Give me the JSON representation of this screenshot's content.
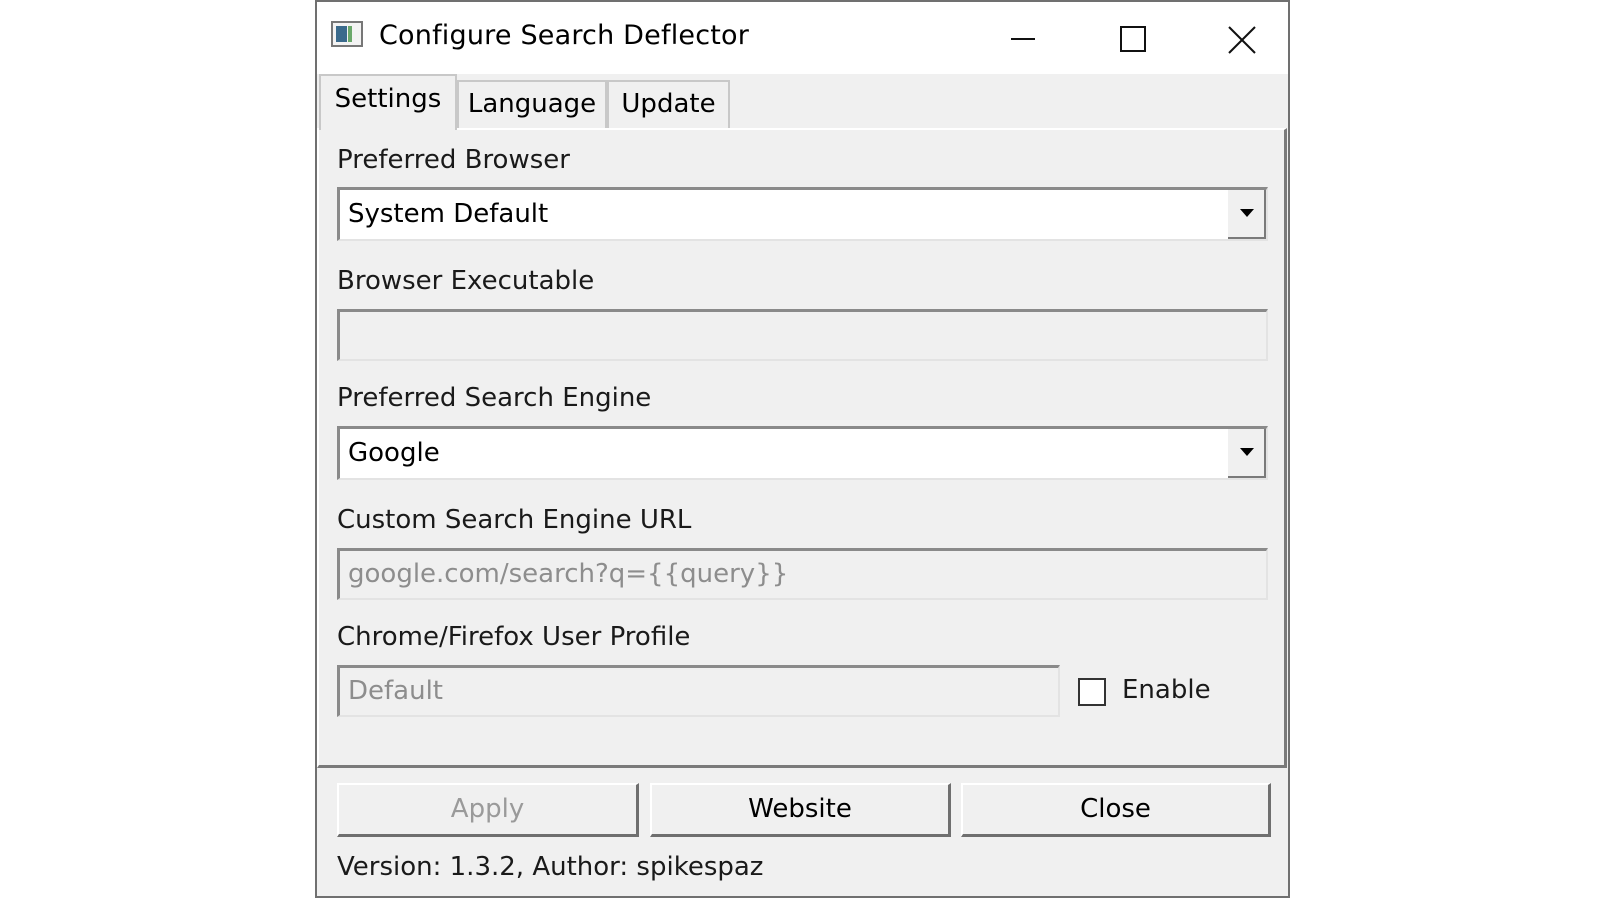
{
  "window": {
    "title": "Configure Search Deflector",
    "controls": {
      "minimize": "minimize-icon",
      "maximize": "maximize-icon",
      "close": "close-icon"
    }
  },
  "tabs": [
    {
      "label": "Settings",
      "active": true
    },
    {
      "label": "Language",
      "active": false
    },
    {
      "label": "Update",
      "active": false
    }
  ],
  "settings": {
    "preferred_browser": {
      "label": "Preferred Browser",
      "value": "System Default"
    },
    "browser_executable": {
      "label": "Browser Executable",
      "value": ""
    },
    "preferred_search_engine": {
      "label": "Preferred Search Engine",
      "value": "Google"
    },
    "custom_search_engine_url": {
      "label": "Custom Search Engine URL",
      "value": "google.com/search?q={{query}}"
    },
    "user_profile": {
      "label": "Chrome/Firefox User Profile",
      "value": "Default",
      "enable_label": "Enable",
      "enabled": false
    }
  },
  "buttons": {
    "apply": "Apply",
    "website": "Website",
    "close": "Close"
  },
  "status": "Version: 1.3.2, Author: spikespaz"
}
